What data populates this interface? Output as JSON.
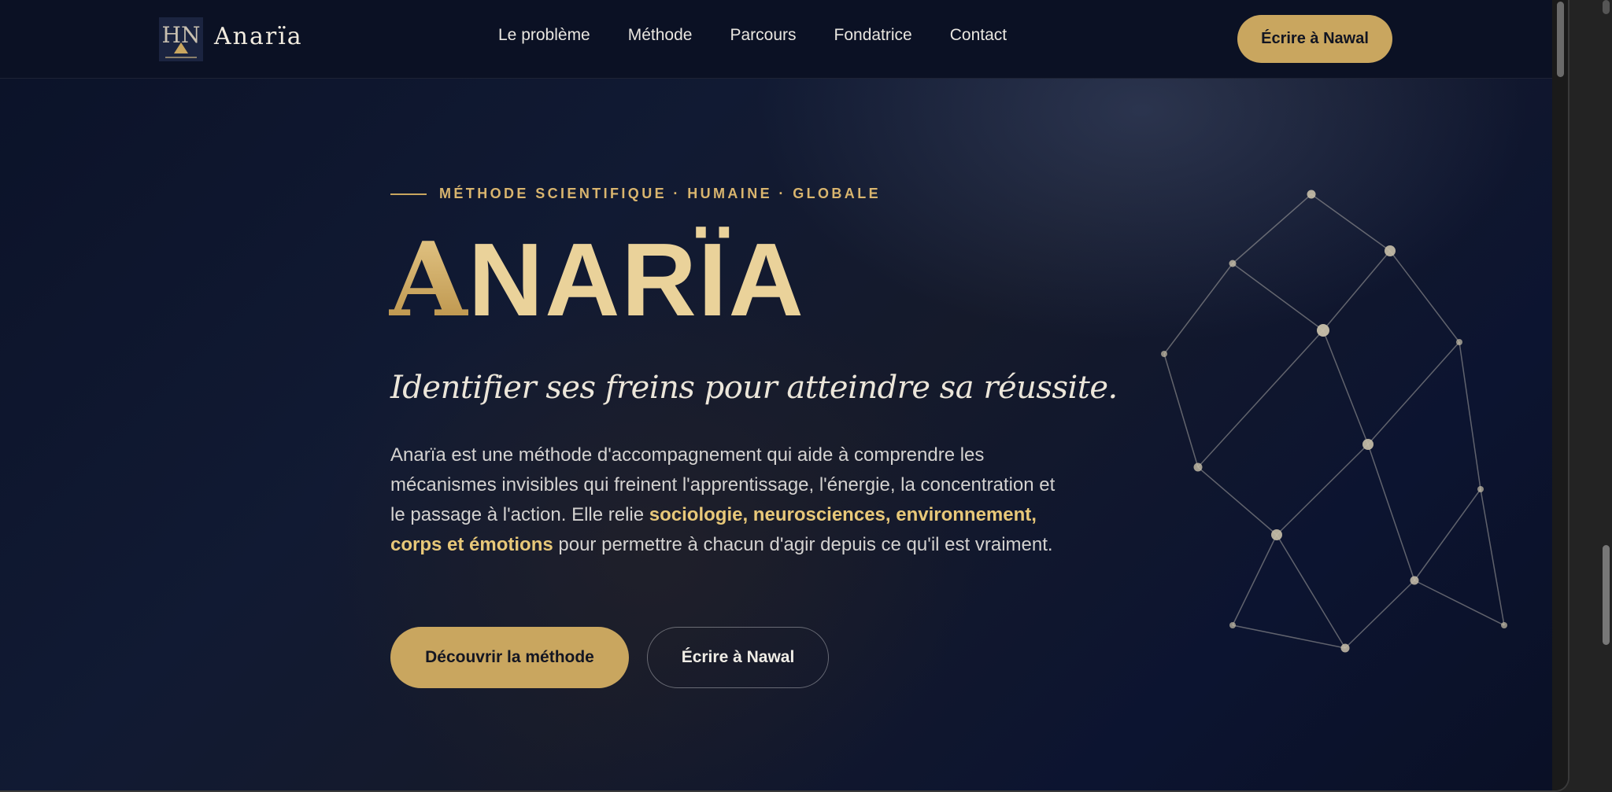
{
  "brand": {
    "name": "Anarïa",
    "logo_icon": "anaria-logo-icon",
    "logo_letters": "HN"
  },
  "nav": {
    "links": [
      {
        "label": "Le problème"
      },
      {
        "label": "Méthode"
      },
      {
        "label": "Parcours"
      },
      {
        "label": "Fondatrice"
      },
      {
        "label": "Contact"
      }
    ],
    "cta_label": "Écrire à Nawal"
  },
  "hero": {
    "eyebrow": "MÉTHODE SCIENTIFIQUE · HUMAINE · GLOBALE",
    "title_first": "A",
    "title_rest": "NARÏA",
    "tagline": "Identifier ses freins pour atteindre sa réussite.",
    "description_part1": "Anarïa est une méthode d'accompagnement qui aide à comprendre les mécanismes invisibles qui freinent l'apprentissage, l'énergie, la concentration et le passage à l'action. Elle relie ",
    "description_highlight": "sociologie, neurosciences, environnement, corps et émotions",
    "description_part2": " pour permettre à chacun d'agir depuis ce qu'il est vraiment.",
    "primary_button": "Découvrir la méthode",
    "secondary_button": "Écrire à Nawal"
  },
  "colors": {
    "gold": "#c9a65f",
    "gold_light": "#ead29a",
    "navy": "#0b1124",
    "text_light": "#d4d2d0"
  },
  "decoration": {
    "icon": "constellation-network-icon"
  }
}
